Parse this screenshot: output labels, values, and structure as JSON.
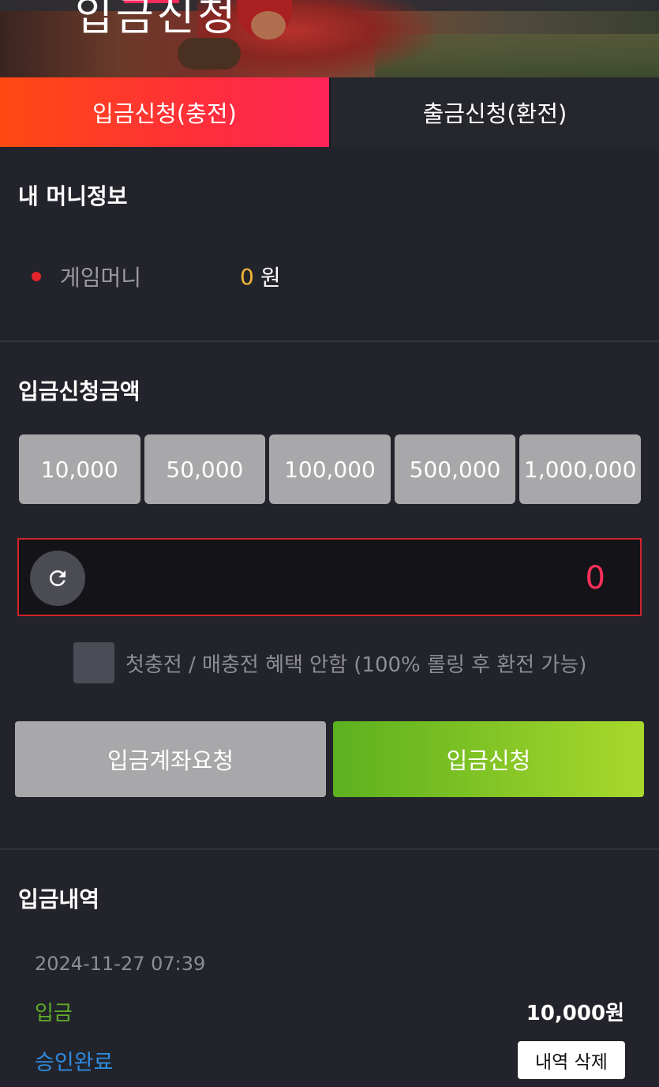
{
  "banner": {
    "title_fragment": "입금신청",
    "image_icon": "baseball-player-banner"
  },
  "tabs": [
    {
      "label": "입금신청(충전)",
      "active": true
    },
    {
      "label": "출금신청(환전)",
      "active": false
    }
  ],
  "money_info": {
    "title": "내 머니정보",
    "rows": [
      {
        "label": "게임머니",
        "value": "0",
        "unit": "원"
      }
    ]
  },
  "deposit_amount": {
    "title": "입금신청금액",
    "quick_amounts": [
      "10,000",
      "50,000",
      "100,000",
      "500,000",
      "1,000,000"
    ],
    "current_value": "0",
    "reset_icon": "refresh-icon",
    "checkbox_label": "첫충전 / 매충전 혜택 안함 (100% 롤링 후 환전 가능)",
    "checkbox_checked": false,
    "account_request_label": "입금계좌요청",
    "submit_label": "입금신청"
  },
  "history": {
    "title": "입금내역",
    "items": [
      {
        "date": "2024-11-27 07:39",
        "type": "입금",
        "amount": "10,000원",
        "status": "승인완료",
        "delete_label": "내역 삭제"
      }
    ]
  },
  "colors": {
    "accent_tab": "#ff2f3a",
    "submit_green": "#86c626",
    "money_value": "#f4b736",
    "status_blue": "#2e8be0",
    "type_green": "#5fae2a",
    "input_border": "#d4232c"
  }
}
